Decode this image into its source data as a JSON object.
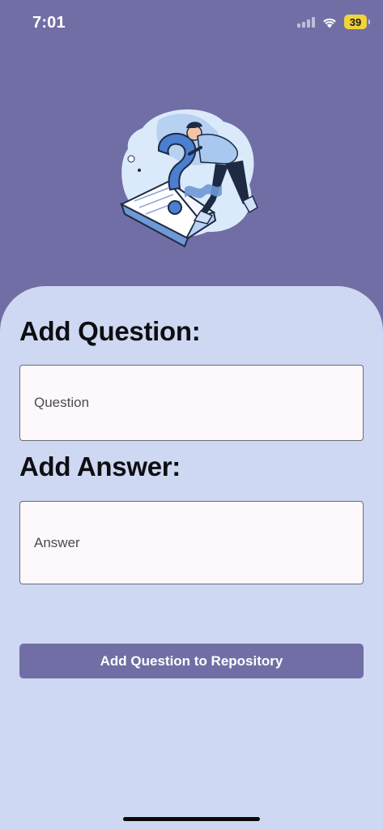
{
  "status_bar": {
    "time": "7:01",
    "battery": "39",
    "icons": [
      "cellular-signal-icon",
      "wifi-icon",
      "battery-icon"
    ]
  },
  "hero": {
    "illustration": "question-mark-person-with-book-illustration"
  },
  "form": {
    "question_heading": "Add Question:",
    "question_placeholder": "Question",
    "question_value": "",
    "answer_heading": "Add Answer:",
    "answer_placeholder": "Answer",
    "answer_value": "",
    "submit_label": "Add Question to Repository"
  },
  "colors": {
    "header_background": "#716ea6",
    "card_background": "#cfd8f2",
    "field_background": "#fdf8fb",
    "button_background": "#716ea6",
    "battery": "#f2d33a"
  }
}
